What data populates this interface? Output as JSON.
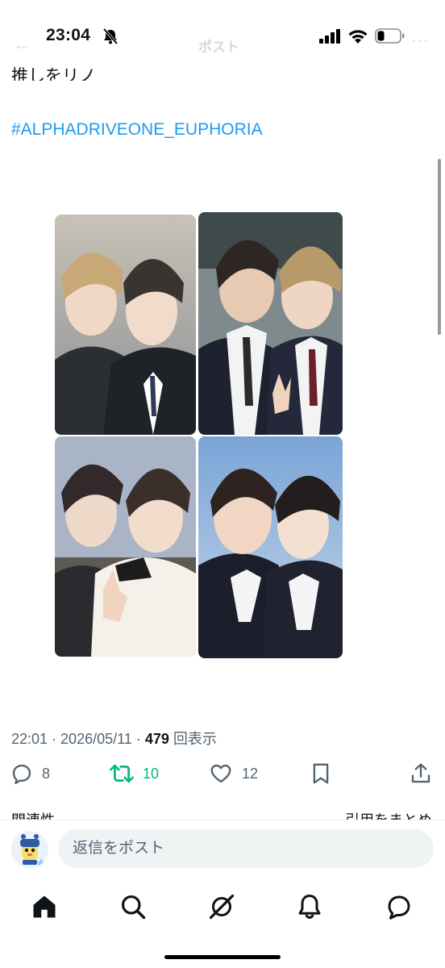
{
  "status": {
    "time": "23:04"
  },
  "header": {
    "title": "ポスト"
  },
  "post": {
    "text_fragment": "推しをリノ",
    "hashtag": "#ALPHADRIVEONE_EUPHORIA",
    "time": "22:01",
    "date": "2026/05/11",
    "views": "479",
    "views_label": "回表示",
    "separator": " · "
  },
  "actions": {
    "replies": "8",
    "reposts": "10",
    "likes": "12"
  },
  "below": {
    "related": "関連性",
    "quotes": "引用をまとめる"
  },
  "reply": {
    "placeholder": "返信をポスト"
  },
  "tabs": [
    "home",
    "search",
    "grok",
    "notifications",
    "messages"
  ],
  "colors": {
    "accent": "#1d9bf0",
    "repost": "#00ba7c",
    "muted": "#536471"
  }
}
